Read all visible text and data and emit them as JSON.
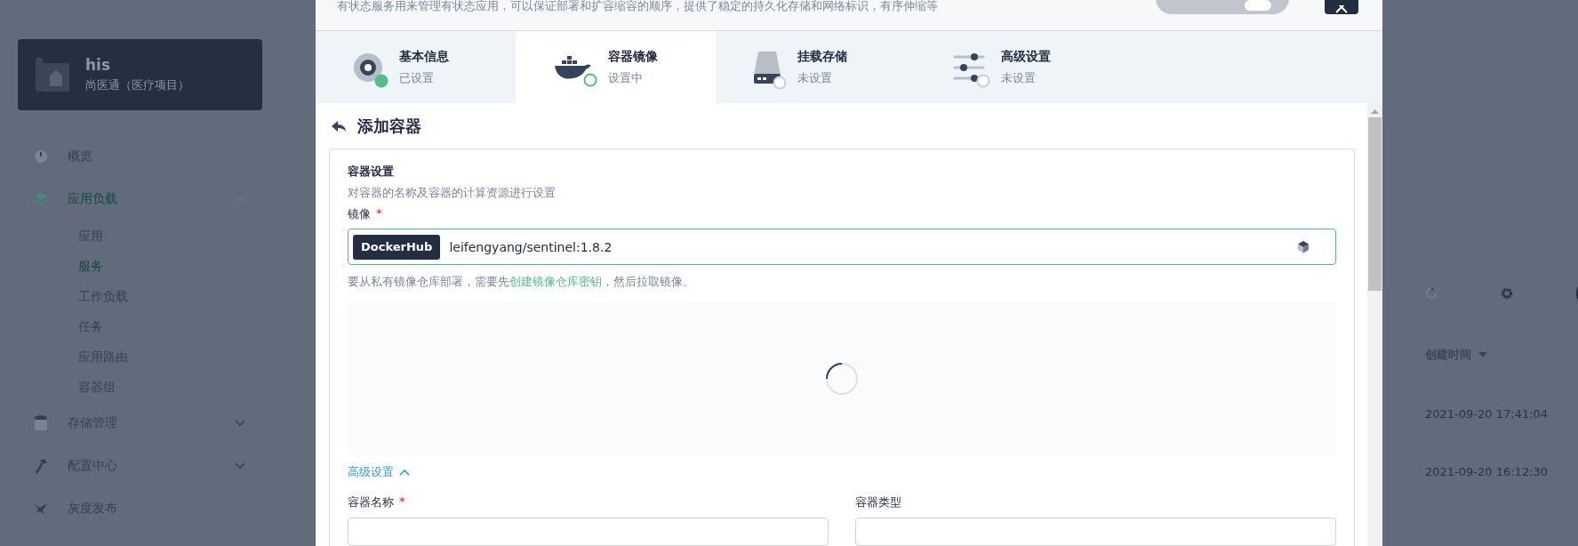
{
  "sidebar": {
    "project": {
      "name": "his",
      "description": "尚医通（医疗项目）"
    },
    "items": [
      {
        "kind": "overview",
        "label": "概览",
        "selected": false
      },
      {
        "kind": "workload",
        "label": "应用负载",
        "expanded": true,
        "selected": true,
        "children": [
          {
            "label": "应用",
            "selected": false
          },
          {
            "label": "服务",
            "selected": true
          },
          {
            "label": "工作负载",
            "selected": false
          },
          {
            "label": "任务",
            "selected": false
          },
          {
            "label": "应用路由",
            "selected": false
          },
          {
            "label": "容器组",
            "selected": false
          }
        ]
      },
      {
        "kind": "storage",
        "label": "存储管理",
        "expanded": false,
        "selected": false
      },
      {
        "kind": "config",
        "label": "配置中心",
        "expanded": false,
        "selected": false
      },
      {
        "kind": "canary",
        "label": "灰度发布",
        "selected": false
      }
    ]
  },
  "background_table": {
    "columns": [
      "创建时间"
    ],
    "rows": [
      "2021-09-20 17:41:04",
      "2021-09-20 16:12:30"
    ]
  },
  "modal": {
    "description": "有状态服务用来管理有状态应用，可以保证部署和扩容缩容的顺序，提供了稳定的持久化存储和网络标识，有序伸缩等",
    "edit_mode": {
      "on": false
    },
    "steps": [
      {
        "kind": "info",
        "title": "基本信息",
        "status": "已设置",
        "complete": true,
        "selected": false
      },
      {
        "kind": "image",
        "title": "容器镜像",
        "status": "设置中",
        "complete": false,
        "selected": true
      },
      {
        "kind": "storage",
        "title": "挂载存储",
        "status": "未设置",
        "complete": false,
        "selected": false
      },
      {
        "kind": "advanced",
        "title": "高级设置",
        "status": "未设置",
        "complete": false,
        "selected": false
      }
    ],
    "page_title": "添加容器",
    "section": {
      "title": "容器设置",
      "description": "对容器的名称及容器的计算资源进行设置",
      "image_label": "镜像",
      "image_required_mark": "*",
      "registry": "DockerHub",
      "image_value": "leifengyang/sentinel:1.8.2",
      "hint": "要从私有镜像仓库部署，需要先**创建镜像仓库密钥**，然后拉取镜像。",
      "advanced": {
        "label": "高级设置",
        "expanded": true
      },
      "fields": [
        {
          "label": "容器名称",
          "required_mark": "*"
        },
        {
          "label": "容器类型"
        }
      ]
    }
  }
}
